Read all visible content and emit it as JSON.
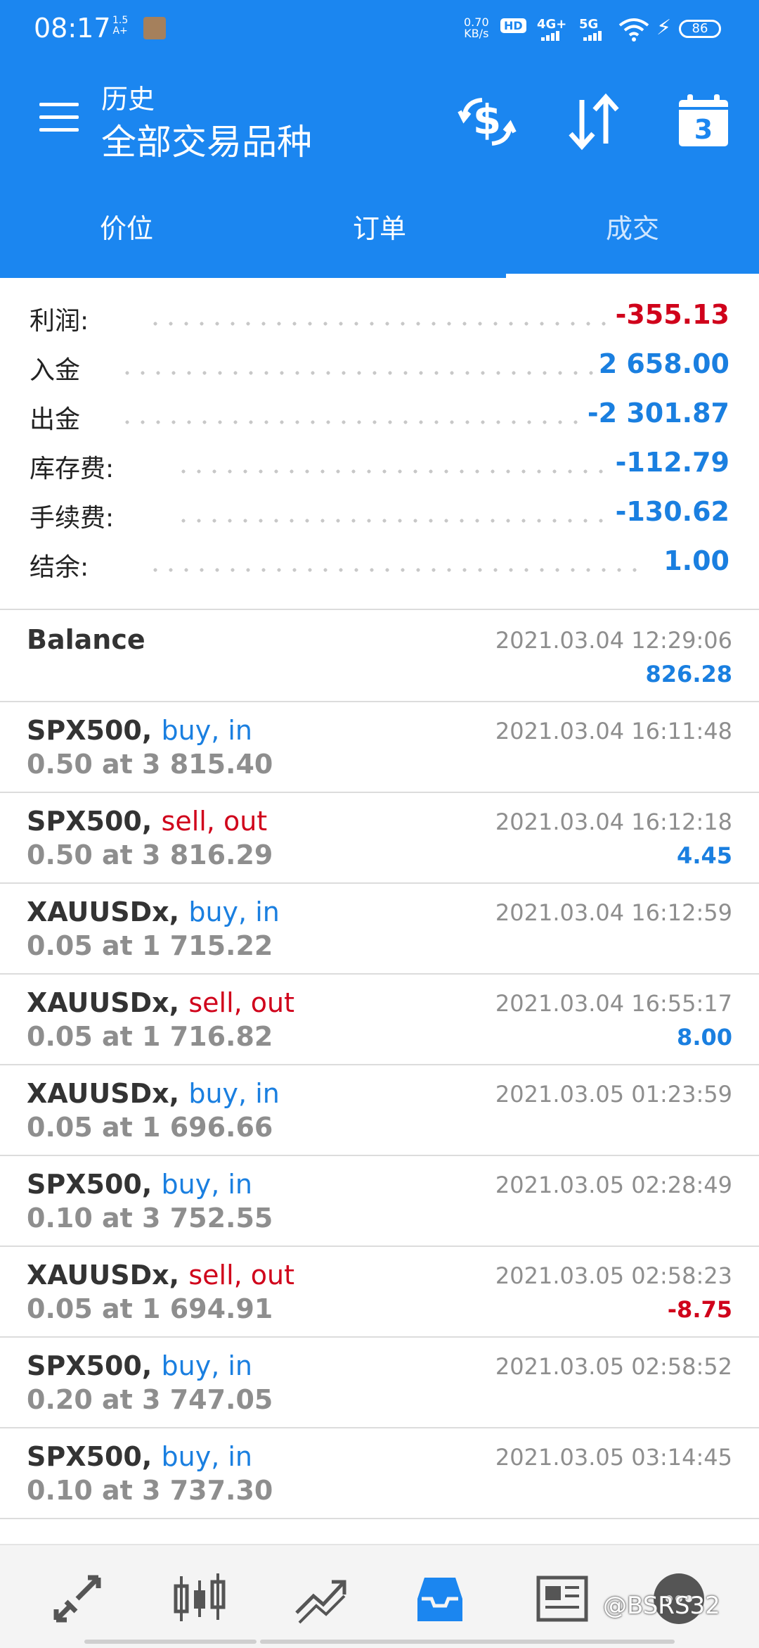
{
  "status_bar": {
    "time": "08:17",
    "small_top": "1.5",
    "small_bottom": "A+",
    "speed_value": "0.70",
    "speed_unit": "KB/s",
    "hd_label": "HD",
    "net1": "4G+",
    "net2": "5G",
    "battery": "86"
  },
  "app_bar": {
    "subtitle": "历史",
    "title": "全部交易品种",
    "calendar_day": "3"
  },
  "tabs": [
    {
      "label": "价位"
    },
    {
      "label": "订单"
    },
    {
      "label": "成交"
    }
  ],
  "summary": [
    {
      "label": "利润:",
      "value": "-355.13",
      "color": "#d0021b"
    },
    {
      "label": "入金",
      "value": "2 658.00",
      "color": "#1a7fe0"
    },
    {
      "label": "出金",
      "value": "-2 301.87",
      "color": "#1a7fe0"
    },
    {
      "label": "库存费:",
      "value": "-112.79",
      "color": "#1a7fe0"
    },
    {
      "label": "手续费:",
      "value": "-130.62",
      "color": "#1a7fe0"
    },
    {
      "label": "结余:",
      "value": "1.00",
      "color": "#1a7fe0"
    }
  ],
  "deals": [
    {
      "symbol": "Balance",
      "side": "",
      "volume": "",
      "time": "2021.03.04 12:29:06",
      "profit": "826.28",
      "side_type": "none",
      "profit_type": "pos"
    },
    {
      "symbol": "SPX500,",
      "side": "buy, in",
      "volume": "0.50 at 3 815.40",
      "time": "2021.03.04 16:11:48",
      "profit": "",
      "side_type": "buy",
      "profit_type": "pos"
    },
    {
      "symbol": "SPX500,",
      "side": "sell, out",
      "volume": "0.50 at 3 816.29",
      "time": "2021.03.04 16:12:18",
      "profit": "4.45",
      "side_type": "sell",
      "profit_type": "pos"
    },
    {
      "symbol": "XAUUSDx,",
      "side": "buy, in",
      "volume": "0.05 at 1 715.22",
      "time": "2021.03.04 16:12:59",
      "profit": "",
      "side_type": "buy",
      "profit_type": "pos"
    },
    {
      "symbol": "XAUUSDx,",
      "side": "sell, out",
      "volume": "0.05 at 1 716.82",
      "time": "2021.03.04 16:55:17",
      "profit": "8.00",
      "side_type": "sell",
      "profit_type": "pos"
    },
    {
      "symbol": "XAUUSDx,",
      "side": "buy, in",
      "volume": "0.05 at 1 696.66",
      "time": "2021.03.05 01:23:59",
      "profit": "",
      "side_type": "buy",
      "profit_type": "pos"
    },
    {
      "symbol": "SPX500,",
      "side": "buy, in",
      "volume": "0.10 at 3 752.55",
      "time": "2021.03.05 02:28:49",
      "profit": "",
      "side_type": "buy",
      "profit_type": "pos"
    },
    {
      "symbol": "XAUUSDx,",
      "side": "sell, out",
      "volume": "0.05 at 1 694.91",
      "time": "2021.03.05 02:58:23",
      "profit": "-8.75",
      "side_type": "sell",
      "profit_type": "neg"
    },
    {
      "symbol": "SPX500,",
      "side": "buy, in",
      "volume": "0.20 at 3 747.05",
      "time": "2021.03.05 02:58:52",
      "profit": "",
      "side_type": "buy",
      "profit_type": "pos"
    },
    {
      "symbol": "SPX500,",
      "side": "buy, in",
      "volume": "0.10 at 3 737.30",
      "time": "2021.03.05 03:14:45",
      "profit": "",
      "side_type": "buy",
      "profit_type": "pos"
    }
  ],
  "colors": {
    "brand": "#1b86f0",
    "buy": "#1a7fe0",
    "sell": "#d0021b",
    "positive": "#1a7fe0",
    "negative": "#d0021b"
  },
  "bottom_nav": {
    "items": [
      {
        "icon": "trade-arrows-icon"
      },
      {
        "icon": "candlestick-chart-icon"
      },
      {
        "icon": "trend-lines-icon"
      },
      {
        "icon": "history-inbox-icon",
        "active": true
      },
      {
        "icon": "news-icon"
      },
      {
        "icon": "chat-icon"
      }
    ],
    "watermark": "@BSRS32"
  }
}
